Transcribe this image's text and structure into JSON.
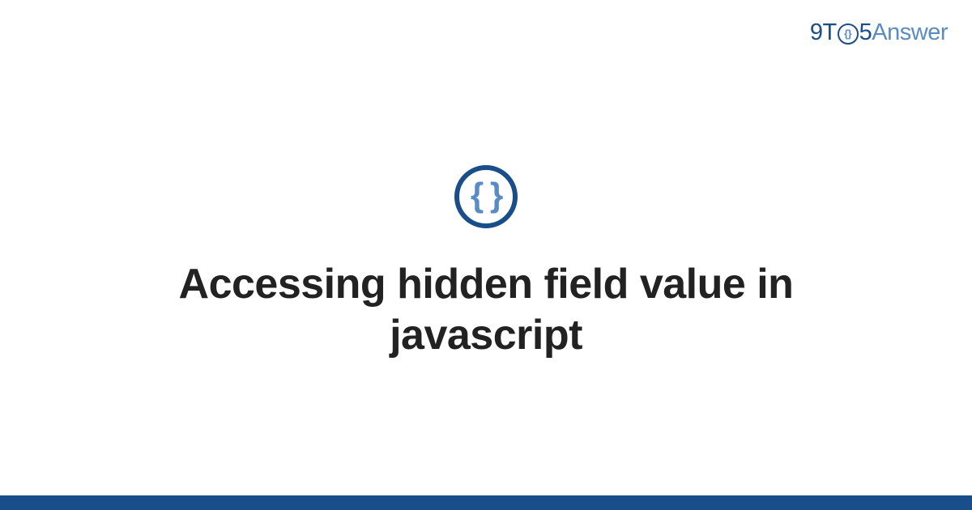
{
  "brand": {
    "part1": "9T",
    "part2_inner": "{}",
    "part3": "5",
    "part4": "Answer"
  },
  "topic_icon": {
    "glyph": "{ }",
    "name": "code-braces"
  },
  "title": "Accessing hidden field value in javascript",
  "colors": {
    "brand_dark": "#1a4e8a",
    "brand_light": "#5a8cc4",
    "text": "#222222",
    "background": "#ffffff"
  }
}
